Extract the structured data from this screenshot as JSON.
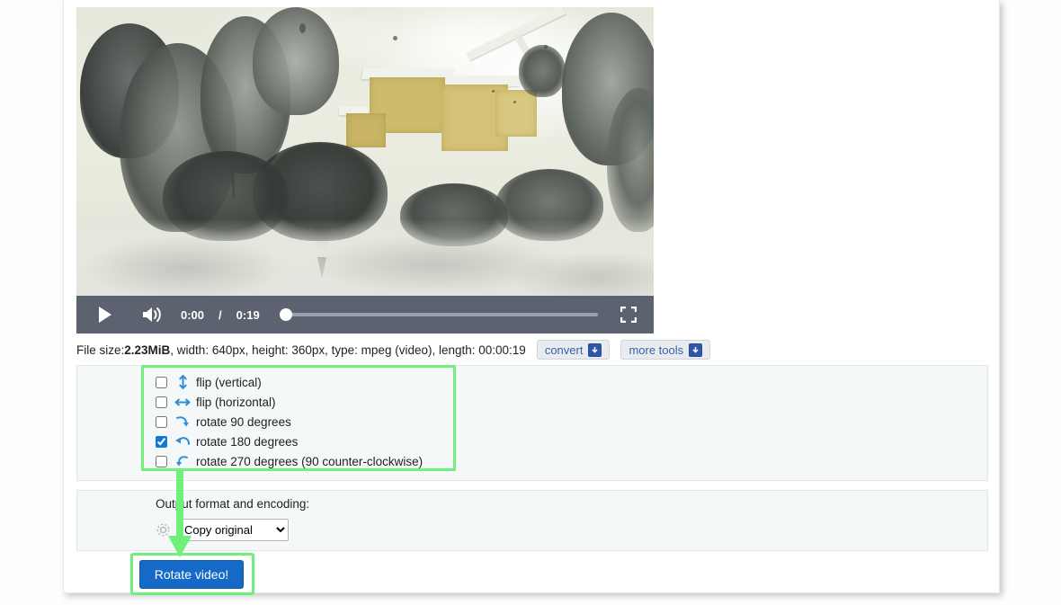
{
  "player": {
    "play_label": "play",
    "volume_label": "volume",
    "current_time": "0:00",
    "separator": "/",
    "duration": "0:19",
    "fullscreen_label": "fullscreen",
    "progress_percent": 0
  },
  "info": {
    "prefix": "File size: ",
    "size": "2.23MiB",
    "rest": ", width: 640px, height: 360px, type: mpeg (video), length: 00:00:19",
    "convert_label": "convert",
    "more_tools_label": "more tools"
  },
  "options": {
    "items": [
      {
        "label": "flip (vertical)",
        "icon": "arrow-up-down-icon",
        "checked": false
      },
      {
        "label": "flip (horizontal)",
        "icon": "arrow-left-right-icon",
        "checked": false
      },
      {
        "label": "rotate 90 degrees",
        "icon": "rotate-90-icon",
        "checked": false
      },
      {
        "label": "rotate 180 degrees",
        "icon": "rotate-180-icon",
        "checked": true
      },
      {
        "label": "rotate 270 degrees (90 counter-clockwise)",
        "icon": "rotate-270-icon",
        "checked": false
      }
    ]
  },
  "output": {
    "label": "Output format and encoding:",
    "selected_format": "Copy original",
    "format_options": [
      "Copy original"
    ]
  },
  "submit": {
    "label": "Rotate video!"
  },
  "colors": {
    "highlight_green": "#6ef07a",
    "button_blue": "#1569c7",
    "panel_bg": "#f4f8f9",
    "control_bar": "#5c6270",
    "link_blue": "#3b5ea8"
  }
}
